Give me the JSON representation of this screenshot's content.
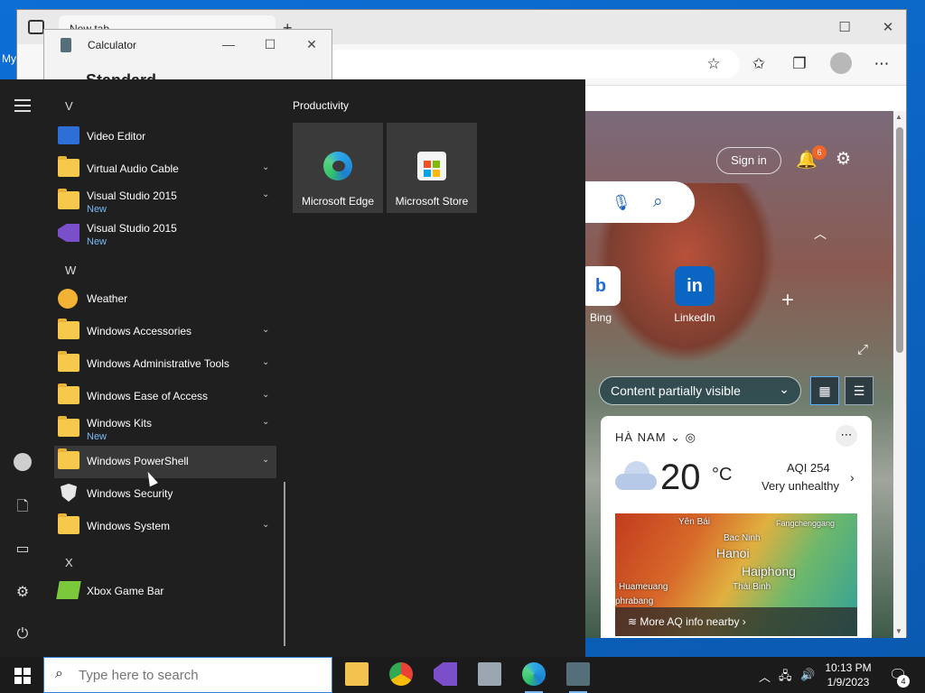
{
  "desktop": {
    "label": "My"
  },
  "edge": {
    "tab_title": "New tab",
    "sign_in": "Sign in",
    "notif_count": "6",
    "quick_links": [
      {
        "label": "Bing",
        "glyph": "b"
      },
      {
        "label": "LinkedIn",
        "glyph": "in"
      }
    ],
    "content_dropdown": "Content partially visible",
    "weather": {
      "location": "HÀ NAM",
      "temp": "20",
      "unit": "°C",
      "aqi": "AQI 254",
      "aqi_status": "Very unhealthy",
      "map_labels": [
        "Yên Bái",
        "Bac Ninh",
        "Hanoi",
        "Haiphong",
        "Thái Binh",
        "Huameuang",
        "phrabang",
        "Fangchenggang"
      ],
      "more_aq": "More AQ info nearby"
    }
  },
  "calculator": {
    "title": "Calculator",
    "mode": "Standard"
  },
  "start_menu": {
    "letters": {
      "v": "V",
      "w": "W",
      "x": "X"
    },
    "apps": [
      {
        "label": "Video Editor",
        "new": ""
      },
      {
        "label": "Virtual Audio Cable",
        "new": ""
      },
      {
        "label": "Visual Studio 2015",
        "new": "New"
      },
      {
        "label": "Visual Studio 2015",
        "new": "New"
      },
      {
        "label": "Weather",
        "new": ""
      },
      {
        "label": "Windows Accessories",
        "new": ""
      },
      {
        "label": "Windows Administrative Tools",
        "new": ""
      },
      {
        "label": "Windows Ease of Access",
        "new": ""
      },
      {
        "label": "Windows Kits",
        "new": "New"
      },
      {
        "label": "Windows PowerShell",
        "new": ""
      },
      {
        "label": "Windows Security",
        "new": ""
      },
      {
        "label": "Windows System",
        "new": ""
      },
      {
        "label": "Xbox Game Bar",
        "new": ""
      }
    ],
    "tile_group": "Productivity",
    "tiles": [
      {
        "label": "Microsoft Edge"
      },
      {
        "label": "Microsoft Store"
      }
    ]
  },
  "taskbar": {
    "search_placeholder": "Type here to search",
    "time": "10:13 PM",
    "date": "1/9/2023",
    "notification_count": "4"
  },
  "colors": {
    "start_bg": "#1f1f1f",
    "accent_blue": "#0a64c8",
    "folder_yellow": "#f6c84c",
    "new_label": "#7ab8f5",
    "badge_orange": "#f06528"
  }
}
